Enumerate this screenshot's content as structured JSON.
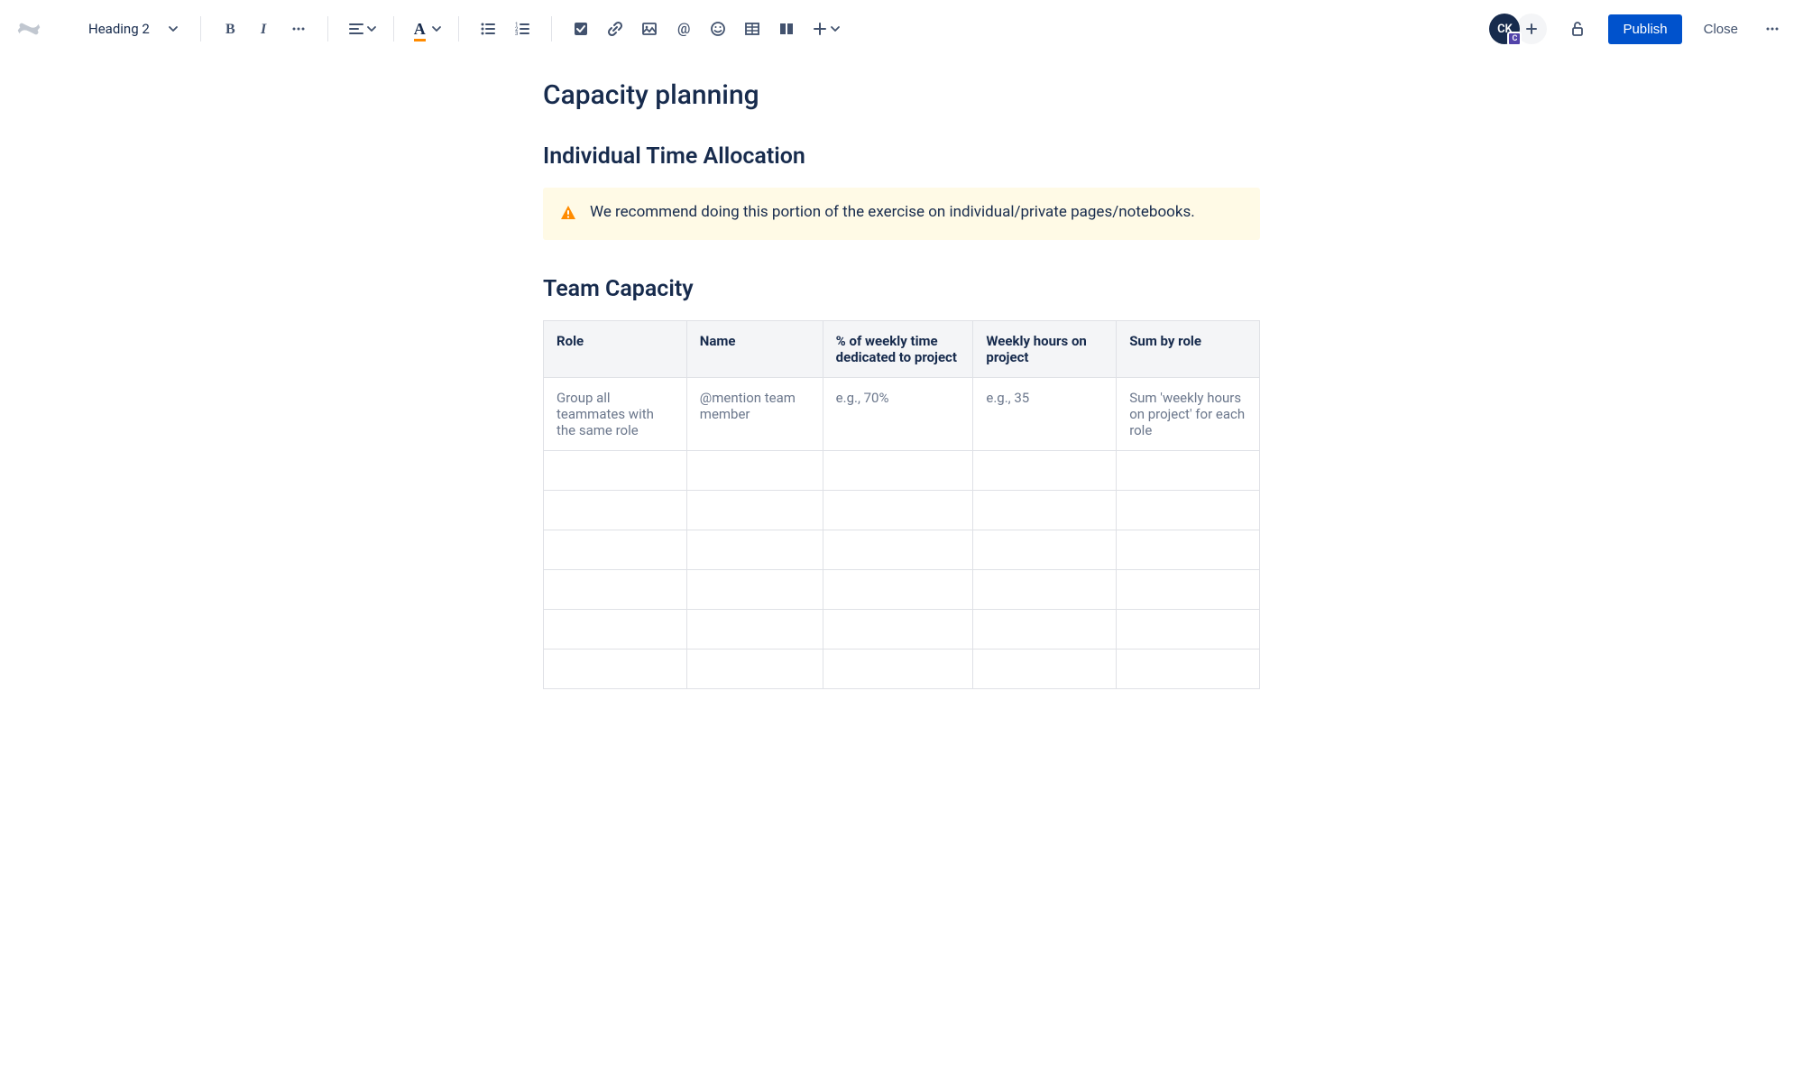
{
  "toolbar": {
    "heading_label": "Heading 2",
    "publish_label": "Publish",
    "close_label": "Close",
    "avatar_initials": "CK",
    "avatar_badge": "C"
  },
  "page": {
    "title": "Capacity planning",
    "section1_heading": "Individual Time Allocation",
    "warning_text": "We recommend doing this portion of the exercise on individual/private pages/notebooks.",
    "section2_heading": "Team Capacity"
  },
  "table": {
    "headers": {
      "col1": "Role",
      "col2": "Name",
      "col3": "% of weekly time dedicated to project",
      "col4": "Weekly hours on project",
      "col5": "Sum by role"
    },
    "row1": {
      "col1": "Group all teammates with the same role",
      "col2": "@mention team member",
      "col3": "e.g., 70%",
      "col4": "e.g., 35",
      "col5": "Sum 'weekly hours on project' for each role"
    }
  }
}
